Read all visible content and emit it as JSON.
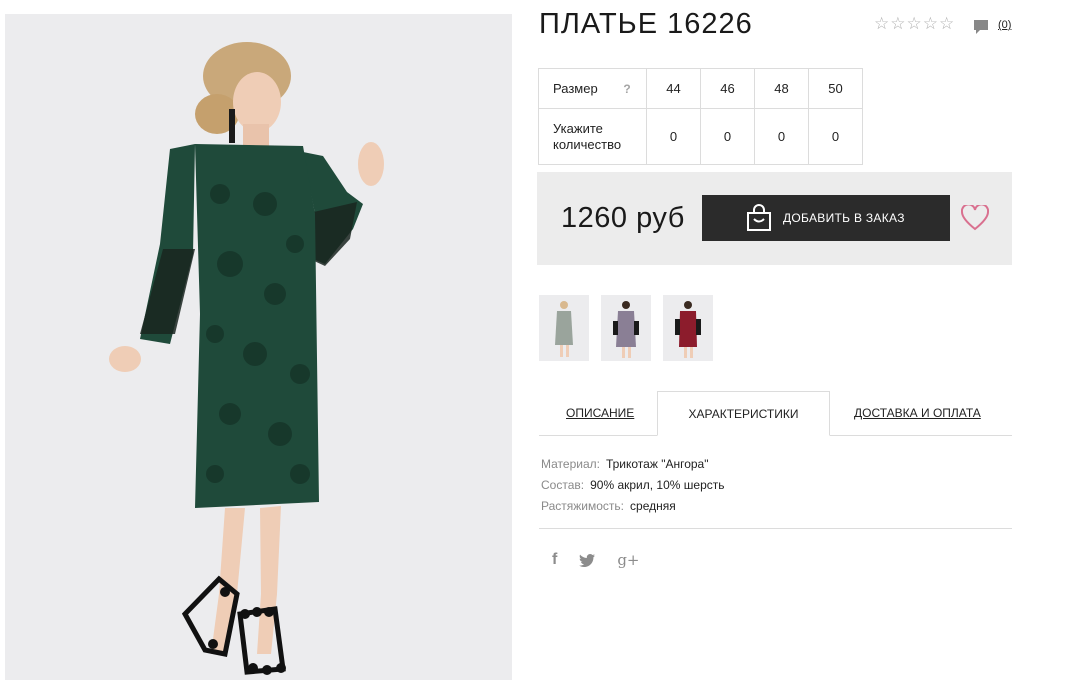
{
  "product": {
    "title": "ПЛАТЬЕ 16226",
    "rating_stars": 5,
    "comment_count": "(0)"
  },
  "size_table": {
    "size_label": "Размер",
    "help_mark": "?",
    "sizes": [
      "44",
      "46",
      "48",
      "50"
    ],
    "qty_label": "Укажите количество",
    "quantities": [
      "0",
      "0",
      "0",
      "0"
    ]
  },
  "purchase": {
    "price": "1260 руб",
    "order_button": "ДОБАВИТЬ В ЗАКАЗ"
  },
  "tabs": {
    "description": "ОПИСАНИЕ",
    "characteristics": "ХАРАКТЕРИСТИКИ",
    "delivery": "ДОСТАВКА И ОПЛАТА",
    "active": "characteristics"
  },
  "specs": [
    {
      "key": "Материал:",
      "value": "Трикотаж \"Ангора\""
    },
    {
      "key": "Состав:",
      "value": "90% акрил, 10% шерсть"
    },
    {
      "key": "Растяжимость:",
      "value": "средняя"
    }
  ],
  "social": {
    "facebook": "f",
    "google": "g+"
  },
  "colors": {
    "dress_main": "#1f4a3a",
    "button_bg": "#2b2b2b",
    "heart": "#d9708f",
    "price_box_bg": "#ececec",
    "thumb_grey": "#9aa49c",
    "thumb_floral": "#8a7f95",
    "thumb_burgundy": "#8c1c2c"
  },
  "icons": [
    "star-icon",
    "comment-icon",
    "help-icon",
    "bag-icon",
    "heart-icon",
    "facebook-icon",
    "twitter-icon",
    "google-plus-icon"
  ]
}
